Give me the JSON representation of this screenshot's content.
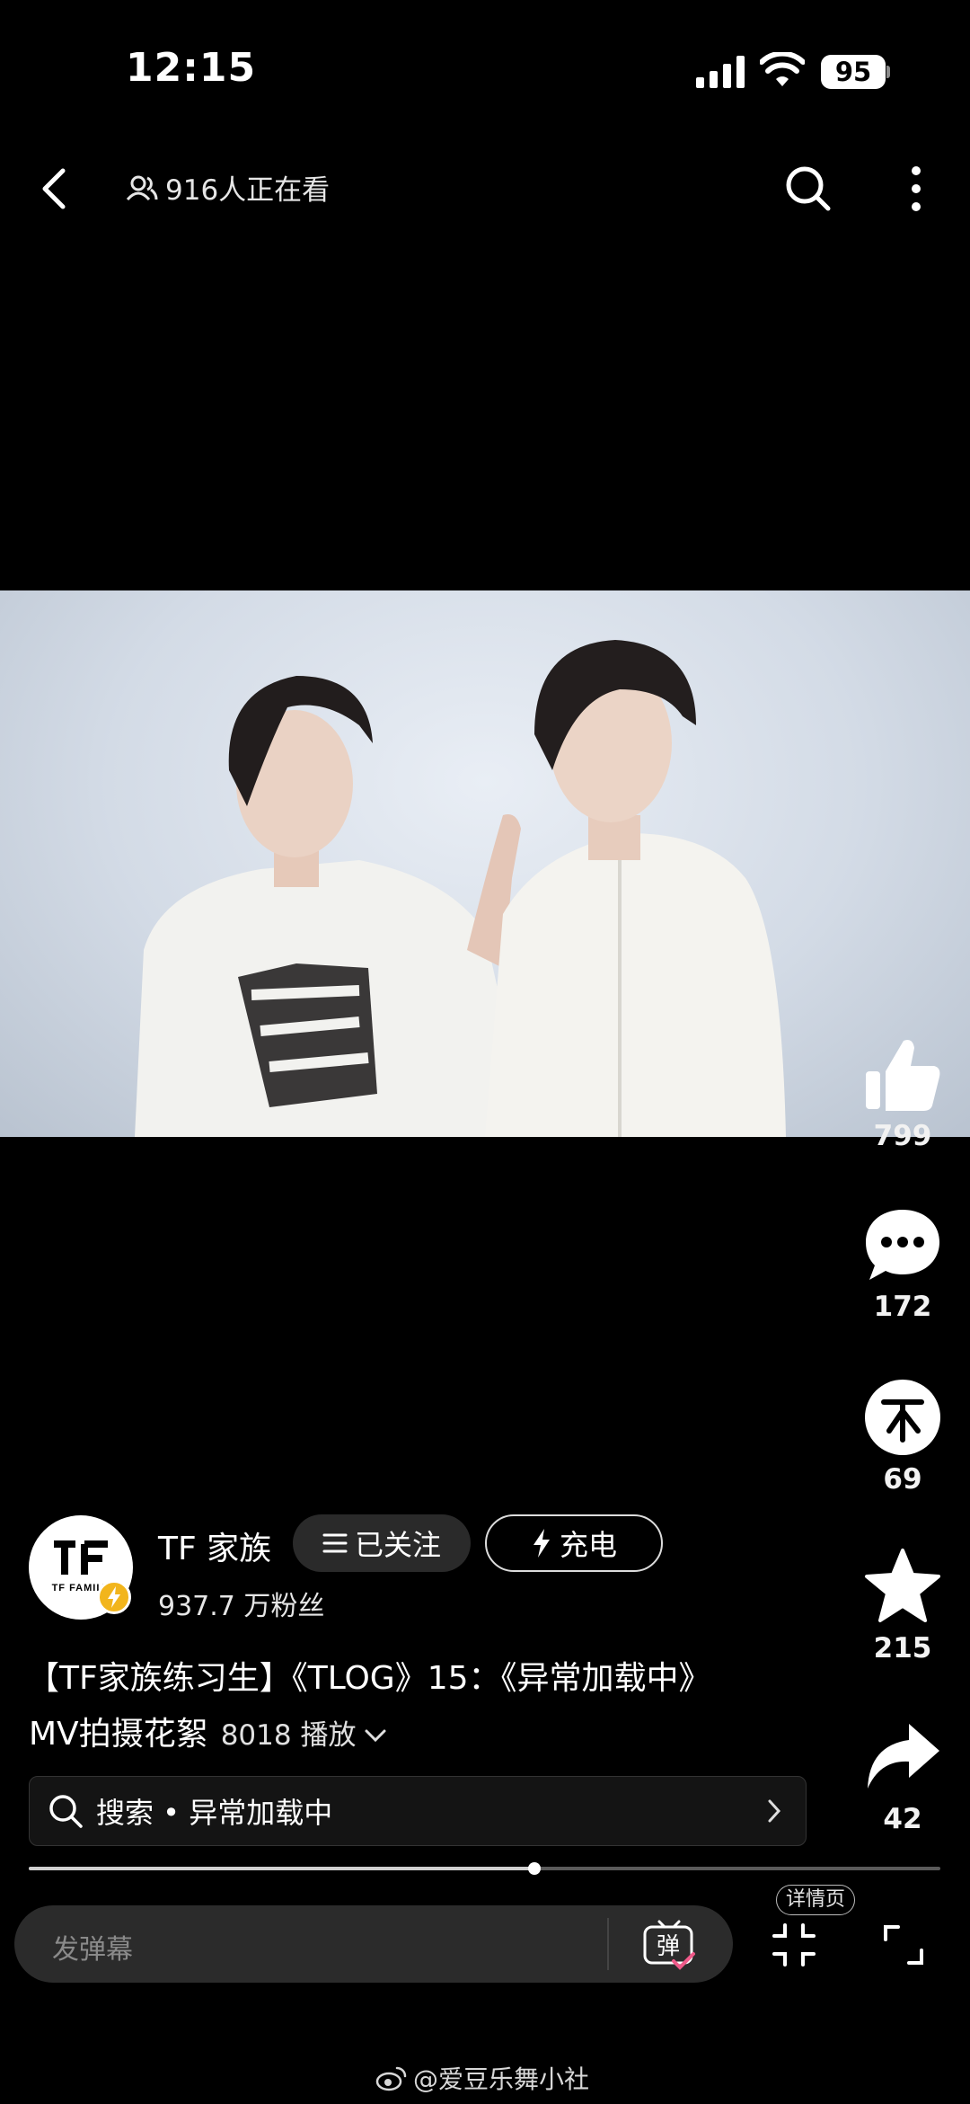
{
  "status_bar": {
    "time": "12:15",
    "battery": "95"
  },
  "top_bar": {
    "viewers": "916人正在看"
  },
  "actions": {
    "likes": "799",
    "comments": "172",
    "coins": "69",
    "favorites": "215",
    "shares": "42"
  },
  "author": {
    "name": "TF 家族",
    "fans": "937.7 万粉丝",
    "follow_label": "已关注",
    "charge_label": "充电",
    "avatar_text": "TF FAMILY"
  },
  "video_info": {
    "title_line1": "【TF家族练习生】《TLOG》15：《异常加载中》",
    "title_line2": "MV拍摄花絮",
    "plays": "8018 播放"
  },
  "search_suggestion": {
    "label": "搜索 • 异常加载中"
  },
  "progress": {
    "fraction": 0.555
  },
  "bottom_bar": {
    "danmaku_placeholder": "发弹幕",
    "danmaku_toggle": "弹",
    "detail_tag": "详情页"
  },
  "watermark": "@爱豆乐舞小社",
  "colors": {
    "background": "#000000",
    "badge": "#f2b51c"
  },
  "icons": [
    "back-icon",
    "viewers-icon",
    "search-icon",
    "more-icon",
    "like-icon",
    "comment-icon",
    "coin-icon",
    "favorite-icon",
    "share-icon",
    "lightning-icon",
    "menu-icon",
    "chevron-right-icon",
    "chevron-down-icon",
    "danmaku-icon",
    "exit-fullscreen-icon",
    "fullscreen-icon",
    "weibo-icon"
  ]
}
